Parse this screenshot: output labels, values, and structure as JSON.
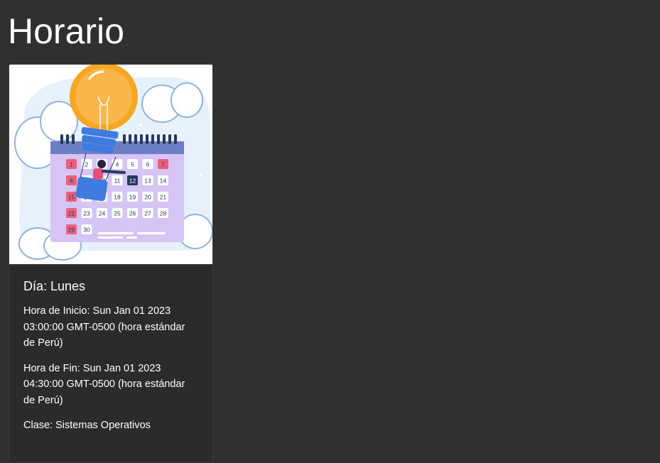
{
  "page": {
    "title": "Horario"
  },
  "card": {
    "image": {
      "description_icon": "calendar-lightbulb-illustration",
      "calendar_days": [
        "1",
        "2",
        "3",
        "4",
        "5",
        "6",
        "7",
        "8",
        "9",
        "10",
        "11",
        "12",
        "13",
        "14",
        "15",
        "16",
        "17",
        "18",
        "19",
        "20",
        "21",
        "22",
        "23",
        "24",
        "25",
        "26",
        "27",
        "28",
        "29",
        "30"
      ]
    },
    "day": "Día: Lunes",
    "start": "Hora de Inicio: Sun Jan 01 2023 03:00:00 GMT-0500 (hora estándar de Perú)",
    "end": "Hora de Fin: Sun Jan 01 2023 04:30:00 GMT-0500 (hora estándar de Perú)",
    "class": "Clase: Sistemas Operativos"
  },
  "colors": {
    "background": "#303030",
    "card": "#2b2b2b",
    "text": "#ffffff"
  }
}
